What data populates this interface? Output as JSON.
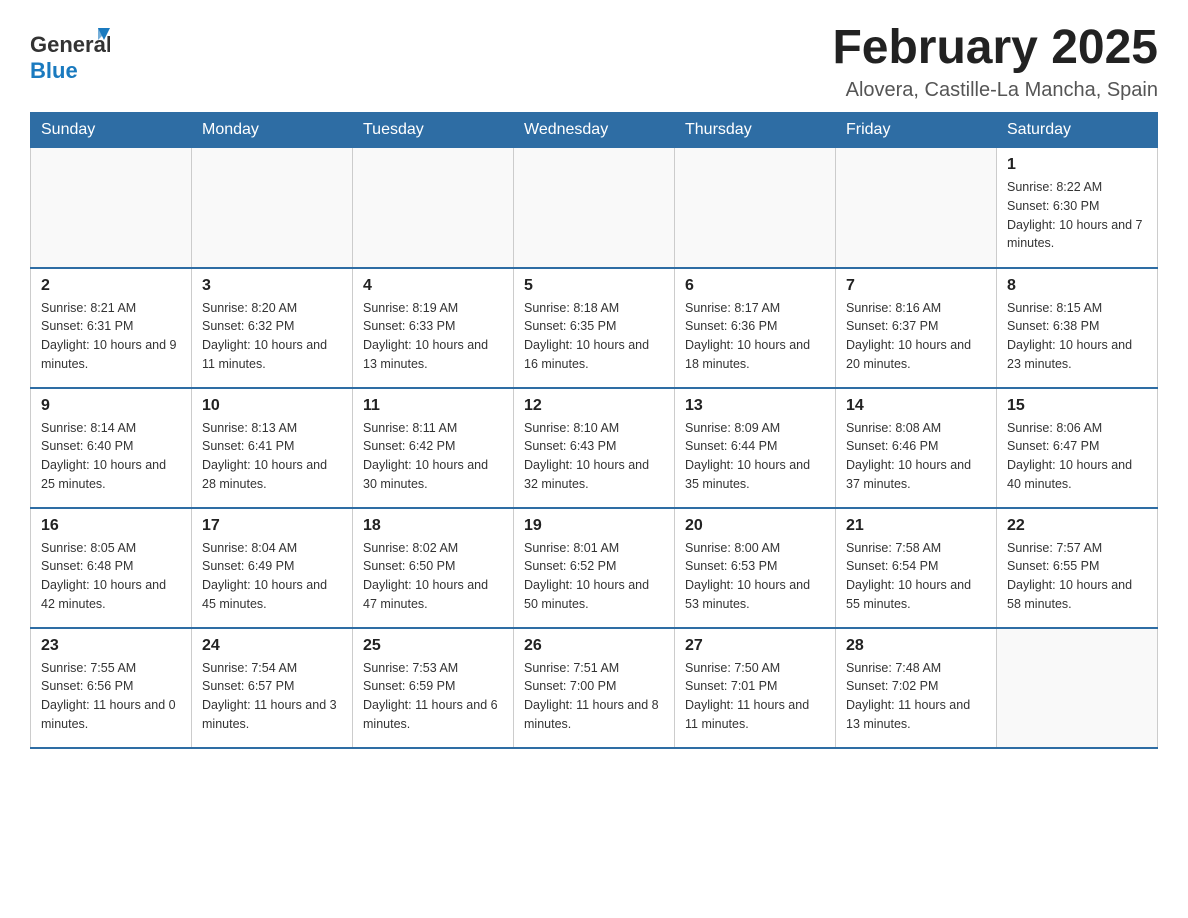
{
  "header": {
    "logo_general": "General",
    "logo_blue": "Blue",
    "title": "February 2025",
    "subtitle": "Alovera, Castille-La Mancha, Spain"
  },
  "calendar": {
    "days_of_week": [
      "Sunday",
      "Monday",
      "Tuesday",
      "Wednesday",
      "Thursday",
      "Friday",
      "Saturday"
    ],
    "weeks": [
      [
        {
          "day": "",
          "info": ""
        },
        {
          "day": "",
          "info": ""
        },
        {
          "day": "",
          "info": ""
        },
        {
          "day": "",
          "info": ""
        },
        {
          "day": "",
          "info": ""
        },
        {
          "day": "",
          "info": ""
        },
        {
          "day": "1",
          "info": "Sunrise: 8:22 AM\nSunset: 6:30 PM\nDaylight: 10 hours and 7 minutes."
        }
      ],
      [
        {
          "day": "2",
          "info": "Sunrise: 8:21 AM\nSunset: 6:31 PM\nDaylight: 10 hours and 9 minutes."
        },
        {
          "day": "3",
          "info": "Sunrise: 8:20 AM\nSunset: 6:32 PM\nDaylight: 10 hours and 11 minutes."
        },
        {
          "day": "4",
          "info": "Sunrise: 8:19 AM\nSunset: 6:33 PM\nDaylight: 10 hours and 13 minutes."
        },
        {
          "day": "5",
          "info": "Sunrise: 8:18 AM\nSunset: 6:35 PM\nDaylight: 10 hours and 16 minutes."
        },
        {
          "day": "6",
          "info": "Sunrise: 8:17 AM\nSunset: 6:36 PM\nDaylight: 10 hours and 18 minutes."
        },
        {
          "day": "7",
          "info": "Sunrise: 8:16 AM\nSunset: 6:37 PM\nDaylight: 10 hours and 20 minutes."
        },
        {
          "day": "8",
          "info": "Sunrise: 8:15 AM\nSunset: 6:38 PM\nDaylight: 10 hours and 23 minutes."
        }
      ],
      [
        {
          "day": "9",
          "info": "Sunrise: 8:14 AM\nSunset: 6:40 PM\nDaylight: 10 hours and 25 minutes."
        },
        {
          "day": "10",
          "info": "Sunrise: 8:13 AM\nSunset: 6:41 PM\nDaylight: 10 hours and 28 minutes."
        },
        {
          "day": "11",
          "info": "Sunrise: 8:11 AM\nSunset: 6:42 PM\nDaylight: 10 hours and 30 minutes."
        },
        {
          "day": "12",
          "info": "Sunrise: 8:10 AM\nSunset: 6:43 PM\nDaylight: 10 hours and 32 minutes."
        },
        {
          "day": "13",
          "info": "Sunrise: 8:09 AM\nSunset: 6:44 PM\nDaylight: 10 hours and 35 minutes."
        },
        {
          "day": "14",
          "info": "Sunrise: 8:08 AM\nSunset: 6:46 PM\nDaylight: 10 hours and 37 minutes."
        },
        {
          "day": "15",
          "info": "Sunrise: 8:06 AM\nSunset: 6:47 PM\nDaylight: 10 hours and 40 minutes."
        }
      ],
      [
        {
          "day": "16",
          "info": "Sunrise: 8:05 AM\nSunset: 6:48 PM\nDaylight: 10 hours and 42 minutes."
        },
        {
          "day": "17",
          "info": "Sunrise: 8:04 AM\nSunset: 6:49 PM\nDaylight: 10 hours and 45 minutes."
        },
        {
          "day": "18",
          "info": "Sunrise: 8:02 AM\nSunset: 6:50 PM\nDaylight: 10 hours and 47 minutes."
        },
        {
          "day": "19",
          "info": "Sunrise: 8:01 AM\nSunset: 6:52 PM\nDaylight: 10 hours and 50 minutes."
        },
        {
          "day": "20",
          "info": "Sunrise: 8:00 AM\nSunset: 6:53 PM\nDaylight: 10 hours and 53 minutes."
        },
        {
          "day": "21",
          "info": "Sunrise: 7:58 AM\nSunset: 6:54 PM\nDaylight: 10 hours and 55 minutes."
        },
        {
          "day": "22",
          "info": "Sunrise: 7:57 AM\nSunset: 6:55 PM\nDaylight: 10 hours and 58 minutes."
        }
      ],
      [
        {
          "day": "23",
          "info": "Sunrise: 7:55 AM\nSunset: 6:56 PM\nDaylight: 11 hours and 0 minutes."
        },
        {
          "day": "24",
          "info": "Sunrise: 7:54 AM\nSunset: 6:57 PM\nDaylight: 11 hours and 3 minutes."
        },
        {
          "day": "25",
          "info": "Sunrise: 7:53 AM\nSunset: 6:59 PM\nDaylight: 11 hours and 6 minutes."
        },
        {
          "day": "26",
          "info": "Sunrise: 7:51 AM\nSunset: 7:00 PM\nDaylight: 11 hours and 8 minutes."
        },
        {
          "day": "27",
          "info": "Sunrise: 7:50 AM\nSunset: 7:01 PM\nDaylight: 11 hours and 11 minutes."
        },
        {
          "day": "28",
          "info": "Sunrise: 7:48 AM\nSunset: 7:02 PM\nDaylight: 11 hours and 13 minutes."
        },
        {
          "day": "",
          "info": ""
        }
      ]
    ]
  }
}
